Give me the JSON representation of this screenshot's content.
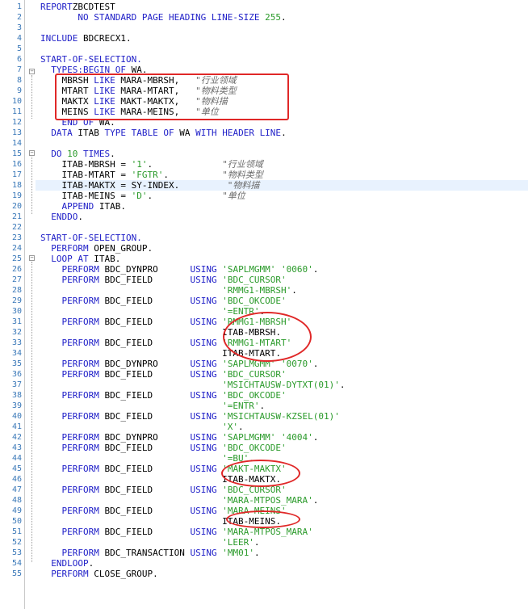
{
  "editor": {
    "lines": [
      {
        "num": "1",
        "segs": [
          [
            "kw",
            "REPORT"
          ],
          [
            "",
            "ZBCDTEST"
          ]
        ]
      },
      {
        "num": "2",
        "segs": [
          [
            "",
            "       "
          ],
          [
            "kw",
            "NO STANDARD PAGE HEADING LINE-SIZE"
          ],
          [
            "",
            ""
          ],
          [
            "num",
            " 255"
          ],
          [
            "",
            "."
          ]
        ]
      },
      {
        "num": "3",
        "segs": []
      },
      {
        "num": "4",
        "segs": [
          [
            "kw",
            "INCLUDE"
          ],
          [
            "",
            " BDCRECX1."
          ]
        ]
      },
      {
        "num": "5",
        "segs": []
      },
      {
        "num": "6",
        "segs": [
          [
            "kw",
            "START-OF-SELECTION."
          ]
        ]
      },
      {
        "num": "7",
        "segs": [
          [
            "",
            "  "
          ],
          [
            "kw",
            "TYPES:BEGIN OF"
          ],
          [
            "",
            " WA."
          ]
        ]
      },
      {
        "num": "8",
        "segs": [
          [
            "",
            "    MBRSH "
          ],
          [
            "kw",
            "LIKE"
          ],
          [
            "",
            " MARA-MBRSH,   "
          ],
          [
            "cmt",
            "\"行业领域"
          ]
        ]
      },
      {
        "num": "9",
        "segs": [
          [
            "",
            "    MTART "
          ],
          [
            "kw",
            "LIKE"
          ],
          [
            "",
            " MARA-MTART,   "
          ],
          [
            "cmt",
            "\"物料类型"
          ]
        ]
      },
      {
        "num": "10",
        "segs": [
          [
            "",
            "    MAKTX "
          ],
          [
            "kw",
            "LIKE"
          ],
          [
            "",
            " MAKT-MAKTX,   "
          ],
          [
            "cmt",
            "\"物料描"
          ]
        ]
      },
      {
        "num": "11",
        "segs": [
          [
            "",
            "    MEINS "
          ],
          [
            "kw",
            "LIKE"
          ],
          [
            "",
            " MARA-MEINS,   "
          ],
          [
            "cmt",
            "\"单位"
          ]
        ]
      },
      {
        "num": "12",
        "segs": [
          [
            "",
            "    "
          ],
          [
            "kw",
            "END OF"
          ],
          [
            "",
            " WA."
          ]
        ]
      },
      {
        "num": "13",
        "segs": [
          [
            "",
            "  "
          ],
          [
            "kw",
            "DATA"
          ],
          [
            "",
            " ITAB "
          ],
          [
            "kw",
            "TYPE TABLE OF"
          ],
          [
            "",
            " WA "
          ],
          [
            "kw",
            "WITH HEADER LINE"
          ],
          [
            "",
            "."
          ]
        ]
      },
      {
        "num": "14",
        "segs": []
      },
      {
        "num": "15",
        "segs": [
          [
            "",
            "  "
          ],
          [
            "kw",
            "DO"
          ],
          [
            "num",
            " 10"
          ],
          [
            "kw",
            " TIMES"
          ],
          [
            "",
            "."
          ]
        ]
      },
      {
        "num": "16",
        "segs": [
          [
            "",
            "    ITAB-MBRSH = "
          ],
          [
            "str",
            "'1'"
          ],
          [
            "",
            ".             "
          ],
          [
            "cmt",
            "\"行业领域"
          ]
        ]
      },
      {
        "num": "17",
        "segs": [
          [
            "",
            "    ITAB-MTART = "
          ],
          [
            "str",
            "'FGTR'"
          ],
          [
            "",
            ".          "
          ],
          [
            "cmt",
            "\"物料类型"
          ]
        ]
      },
      {
        "num": "18",
        "segs": [
          [
            "",
            "    ITAB-MAKTX = SY-INDEX.         "
          ],
          [
            "cmt",
            "\"物料描"
          ]
        ]
      },
      {
        "num": "19",
        "segs": [
          [
            "",
            "    ITAB-MEINS = "
          ],
          [
            "str",
            "'D'"
          ],
          [
            "",
            ".             "
          ],
          [
            "cmt",
            "\"单位"
          ]
        ]
      },
      {
        "num": "20",
        "segs": [
          [
            "",
            "    "
          ],
          [
            "kw",
            "APPEND"
          ],
          [
            "",
            " ITAB."
          ]
        ]
      },
      {
        "num": "21",
        "segs": [
          [
            "",
            "  "
          ],
          [
            "kw",
            "ENDDO"
          ],
          [
            "",
            "."
          ]
        ]
      },
      {
        "num": "22",
        "segs": []
      },
      {
        "num": "23",
        "segs": [
          [
            "kw",
            "START-OF-SELECTION."
          ]
        ]
      },
      {
        "num": "24",
        "segs": [
          [
            "",
            "  "
          ],
          [
            "kw",
            "PERFORM"
          ],
          [
            "",
            " OPEN_GROUP."
          ]
        ]
      },
      {
        "num": "25",
        "segs": [
          [
            "",
            "  "
          ],
          [
            "kw",
            "LOOP AT"
          ],
          [
            "",
            " ITAB."
          ]
        ]
      },
      {
        "num": "26",
        "segs": [
          [
            "",
            "    "
          ],
          [
            "kw",
            "PERFORM"
          ],
          [
            "",
            " BDC_DYNPRO      "
          ],
          [
            "kw",
            "USING"
          ],
          [
            "str",
            " 'SAPLMGMM' '0060'"
          ],
          [
            "",
            "."
          ]
        ]
      },
      {
        "num": "27",
        "segs": [
          [
            "",
            "    "
          ],
          [
            "kw",
            "PERFORM"
          ],
          [
            "",
            " BDC_FIELD       "
          ],
          [
            "kw",
            "USING"
          ],
          [
            "str",
            " 'BDC_CURSOR'"
          ]
        ]
      },
      {
        "num": "28",
        "segs": [
          [
            "",
            "                                  "
          ],
          [
            "str",
            "'RMMG1-MBRSH'"
          ],
          [
            "",
            "."
          ]
        ]
      },
      {
        "num": "29",
        "segs": [
          [
            "",
            "    "
          ],
          [
            "kw",
            "PERFORM"
          ],
          [
            "",
            " BDC_FIELD       "
          ],
          [
            "kw",
            "USING"
          ],
          [
            "str",
            " 'BDC_OKCODE'"
          ]
        ]
      },
      {
        "num": "30",
        "segs": [
          [
            "",
            "                                  "
          ],
          [
            "str",
            "'=ENTR'"
          ],
          [
            "",
            "."
          ]
        ]
      },
      {
        "num": "31",
        "segs": [
          [
            "",
            "    "
          ],
          [
            "kw",
            "PERFORM"
          ],
          [
            "",
            " BDC_FIELD       "
          ],
          [
            "kw",
            "USING"
          ],
          [
            "str",
            " 'RMMG1-MBRSH'"
          ]
        ]
      },
      {
        "num": "32",
        "segs": [
          [
            "",
            "                                  ITAB-MBRSH."
          ]
        ]
      },
      {
        "num": "33",
        "segs": [
          [
            "",
            "    "
          ],
          [
            "kw",
            "PERFORM"
          ],
          [
            "",
            " BDC_FIELD       "
          ],
          [
            "kw",
            "USING"
          ],
          [
            "str",
            " 'RMMG1-MTART'"
          ]
        ]
      },
      {
        "num": "34",
        "segs": [
          [
            "",
            "                                  ITAB-MTART."
          ]
        ]
      },
      {
        "num": "35",
        "segs": [
          [
            "",
            "    "
          ],
          [
            "kw",
            "PERFORM"
          ],
          [
            "",
            " BDC_DYNPRO      "
          ],
          [
            "kw",
            "USING"
          ],
          [
            "str",
            " 'SAPLMGMM' '0070'"
          ],
          [
            "",
            "."
          ]
        ]
      },
      {
        "num": "36",
        "segs": [
          [
            "",
            "    "
          ],
          [
            "kw",
            "PERFORM"
          ],
          [
            "",
            " BDC_FIELD       "
          ],
          [
            "kw",
            "USING"
          ],
          [
            "str",
            " 'BDC_CURSOR'"
          ]
        ]
      },
      {
        "num": "37",
        "segs": [
          [
            "",
            "                                  "
          ],
          [
            "str",
            "'MSICHTAUSW-DYTXT(01)'"
          ],
          [
            "",
            "."
          ]
        ]
      },
      {
        "num": "38",
        "segs": [
          [
            "",
            "    "
          ],
          [
            "kw",
            "PERFORM"
          ],
          [
            "",
            " BDC_FIELD       "
          ],
          [
            "kw",
            "USING"
          ],
          [
            "str",
            " 'BDC_OKCODE'"
          ]
        ]
      },
      {
        "num": "39",
        "segs": [
          [
            "",
            "                                  "
          ],
          [
            "str",
            "'=ENTR'"
          ],
          [
            "",
            "."
          ]
        ]
      },
      {
        "num": "40",
        "segs": [
          [
            "",
            "    "
          ],
          [
            "kw",
            "PERFORM"
          ],
          [
            "",
            " BDC_FIELD       "
          ],
          [
            "kw",
            "USING"
          ],
          [
            "str",
            " 'MSICHTAUSW-KZSEL(01)'"
          ]
        ]
      },
      {
        "num": "41",
        "segs": [
          [
            "",
            "                                  "
          ],
          [
            "str",
            "'X'"
          ],
          [
            "",
            "."
          ]
        ]
      },
      {
        "num": "42",
        "segs": [
          [
            "",
            "    "
          ],
          [
            "kw",
            "PERFORM"
          ],
          [
            "",
            " BDC_DYNPRO      "
          ],
          [
            "kw",
            "USING"
          ],
          [
            "str",
            " 'SAPLMGMM' '4004'"
          ],
          [
            "",
            "."
          ]
        ]
      },
      {
        "num": "43",
        "segs": [
          [
            "",
            "    "
          ],
          [
            "kw",
            "PERFORM"
          ],
          [
            "",
            " BDC_FIELD       "
          ],
          [
            "kw",
            "USING"
          ],
          [
            "str",
            " 'BDC_OKCODE'"
          ]
        ]
      },
      {
        "num": "44",
        "segs": [
          [
            "",
            "                                  "
          ],
          [
            "str",
            "'=BU'"
          ],
          [
            "",
            "."
          ]
        ]
      },
      {
        "num": "45",
        "segs": [
          [
            "",
            "    "
          ],
          [
            "kw",
            "PERFORM"
          ],
          [
            "",
            " BDC_FIELD       "
          ],
          [
            "kw",
            "USING"
          ],
          [
            "str",
            " 'MAKT-MAKTX'"
          ]
        ]
      },
      {
        "num": "46",
        "segs": [
          [
            "",
            "                                  ITAB-MAKTX."
          ]
        ]
      },
      {
        "num": "47",
        "segs": [
          [
            "",
            "    "
          ],
          [
            "kw",
            "PERFORM"
          ],
          [
            "",
            " BDC_FIELD       "
          ],
          [
            "kw",
            "USING"
          ],
          [
            "str",
            " 'BDC_CURSOR'"
          ]
        ]
      },
      {
        "num": "48",
        "segs": [
          [
            "",
            "                                  "
          ],
          [
            "str",
            "'MARA-MTPOS_MARA'"
          ],
          [
            "",
            "."
          ]
        ]
      },
      {
        "num": "49",
        "segs": [
          [
            "",
            "    "
          ],
          [
            "kw",
            "PERFORM"
          ],
          [
            "",
            " BDC_FIELD       "
          ],
          [
            "kw",
            "USING"
          ],
          [
            "str",
            " 'MARA-MEINS'"
          ]
        ]
      },
      {
        "num": "50",
        "segs": [
          [
            "",
            "                                  ITAB-MEINS."
          ]
        ]
      },
      {
        "num": "51",
        "segs": [
          [
            "",
            "    "
          ],
          [
            "kw",
            "PERFORM"
          ],
          [
            "",
            " BDC_FIELD       "
          ],
          [
            "kw",
            "USING"
          ],
          [
            "str",
            " 'MARA-MTPOS_MARA'"
          ]
        ]
      },
      {
        "num": "52",
        "segs": [
          [
            "",
            "                                  "
          ],
          [
            "str",
            "'LEER'"
          ],
          [
            "",
            "."
          ]
        ]
      },
      {
        "num": "53",
        "segs": [
          [
            "",
            "    "
          ],
          [
            "kw",
            "PERFORM"
          ],
          [
            "",
            " BDC_TRANSACTION "
          ],
          [
            "kw",
            "USING"
          ],
          [
            "str",
            " 'MM01'"
          ],
          [
            "",
            "."
          ]
        ]
      },
      {
        "num": "54",
        "segs": [
          [
            "",
            "  "
          ],
          [
            "kw",
            "ENDLOOP"
          ],
          [
            "",
            "."
          ]
        ]
      },
      {
        "num": "55",
        "segs": [
          [
            "",
            "  "
          ],
          [
            "kw",
            "PERFORM"
          ],
          [
            "",
            " CLOSE_GROUP."
          ]
        ]
      }
    ]
  },
  "colors": {
    "keyword": "#2020c8",
    "string": "#2a9a2a",
    "comment": "#6a6a6a",
    "line_number": "#3a78b8",
    "annotation": "#e02828",
    "current_line": "#e8f2fe"
  }
}
